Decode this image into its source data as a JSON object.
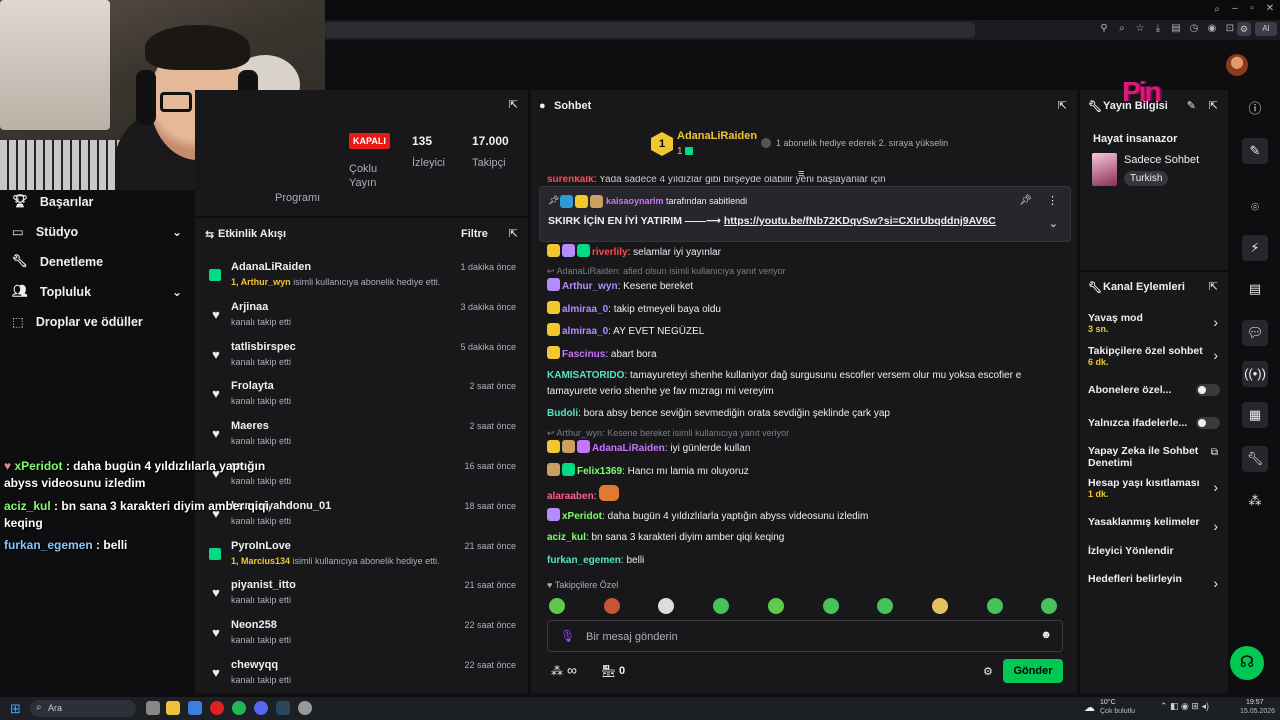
{
  "colors": {
    "accent": "#9147ff",
    "green": "#00db84",
    "send": "#00c853",
    "gold": "#f0c72f",
    "live_red": "#e91916"
  },
  "browser": {
    "taskbar_search": "Ara",
    "clock_time": "19:57",
    "clock_date": "15.05.2026",
    "weather_temp": "10°C",
    "weather_desc": "Çok bulutlu"
  },
  "left_nav": {
    "items": [
      {
        "label": "Başarılar",
        "icon": "trophy-icon"
      },
      {
        "label": "Stüdyo",
        "icon": "studio-icon"
      },
      {
        "label": "Denetleme",
        "icon": "wrench-icon"
      },
      {
        "label": "Topluluk",
        "icon": "community-icon"
      },
      {
        "label": "Droplar ve ödüller",
        "icon": "drops-icon"
      }
    ]
  },
  "overlay_chat": [
    {
      "user": "xPeridot",
      "text": " : daha bugün 4 yıldızlılarla yaptığın abyss videosunu izledim",
      "color": "#7dff6b"
    },
    {
      "user": "aciz_kul",
      "text": " : bn sana 3 karakteri diyim amber qiqi keqing",
      "color": "#7dff6b"
    },
    {
      "user": "furkan_egemen",
      "text": " : belli",
      "color": "#86c6ff"
    }
  ],
  "stats": {
    "program_label": "Programı",
    "live_badge": "KAPALI",
    "mode_label": "Çoklu Yayın",
    "viewers_value": "135",
    "viewers_label": "İzleyici",
    "followers_value": "17.000",
    "followers_label": "Takipçi"
  },
  "activity": {
    "title": "Etkinlik Akışı",
    "filter_label": "Filtre",
    "items": [
      {
        "name": "AdanaLiRaiden",
        "sub_highlight": "1, Arthur_wyn",
        "sub": " isimli kullanıcıya abonelik hediye etti.",
        "time": "1 dakika önce",
        "icon": "gift-icon"
      },
      {
        "name": "Arjinaa",
        "sub_highlight": "",
        "sub": "kanalı takip etti",
        "time": "3 dakika önce",
        "icon": "heart-icon"
      },
      {
        "name": "tatlisbirspec",
        "sub_highlight": "",
        "sub": "kanalı takip etti",
        "time": "5 dakika önce",
        "icon": "heart-icon"
      },
      {
        "name": "Frolayta",
        "sub_highlight": "",
        "sub": "kanalı takip etti",
        "time": "2 saat önce",
        "icon": "heart-icon"
      },
      {
        "name": "Maeres",
        "sub_highlight": "",
        "sub": "kanalı takip etti",
        "time": "2 saat önce",
        "icon": "heart-icon"
      },
      {
        "name": "ra",
        "sub_highlight": "",
        "sub": "kanalı takip etti",
        "time": "16 saat önce",
        "icon": "heart-icon"
      },
      {
        "name": "bunusiyahdonu_01",
        "sub_highlight": "",
        "sub": "kanalı takip etti",
        "time": "18 saat önce",
        "icon": "heart-icon"
      },
      {
        "name": "PyroInLove",
        "sub_highlight": "1, Marcius134",
        "sub": " isimli kullanıcıya abonelik hediye etti.",
        "time": "21 saat önce",
        "icon": "gift-icon"
      },
      {
        "name": "piyanist_itto",
        "sub_highlight": "",
        "sub": "kanalı takip etti",
        "time": "21 saat önce",
        "icon": "heart-icon"
      },
      {
        "name": "Neon258",
        "sub_highlight": "",
        "sub": "kanalı takip etti",
        "time": "22 saat önce",
        "icon": "heart-icon"
      },
      {
        "name": "chewyqq",
        "sub_highlight": "",
        "sub": "kanalı takip etti",
        "time": "22 saat önce",
        "icon": "heart-icon"
      }
    ]
  },
  "chat": {
    "title": "Sohbet",
    "top_gifter": {
      "name": "AdanaLiRaiden",
      "count": "1",
      "rank": "1"
    },
    "gift_hint": "1 abonelik hediye ederek 2. sıraya yükselin",
    "partial_line": {
      "user": "surenkalk",
      "text": ": Yada sadece 4 yıldızlar gibi birşeyde olabilir yeni başlayanlar için"
    },
    "pinned": {
      "pinner": "kaisaoynarim",
      "pinned_by_suffix": " tarafından sabitlendi",
      "text": "SKIRK İÇİN EN İYİ YATIRIM ——⟶ ",
      "link": "https://youtu.be/fNb72KDqvSw?si=CXIrUbqddnj9AV6C"
    },
    "messages": [
      {
        "user": "riverlily",
        "text": ": selamlar iyi yayınlar",
        "color": "#ff4d4d"
      },
      {
        "reply": "AdanaLiRaiden: afied olsun isimli kullanıcıya yanıt veriyor"
      },
      {
        "user": "Arthur_wyn",
        "text": ": Kesene bereket",
        "color": "#b58cff"
      },
      {
        "user": "almiraa_0",
        "text": ": takip etmeyeli baya oldu",
        "color": "#b58cff"
      },
      {
        "user": "almiraa_0",
        "text": ": AY EVET NEGÜZEL",
        "color": "#b58cff"
      },
      {
        "user": "Fascinus",
        "text": ": abart bora",
        "color": "#c774ff"
      },
      {
        "user": "KAMISATORIDO",
        "text": ": tamayureteyi shenhe kullaniyor dağ surgusunu escofier versem olur mu yoksa escofier e tamayurete verio shenhe ye fav mızragı mi vereyim",
        "color": "#55e6c1"
      },
      {
        "user": "Budoli",
        "text": ": bora absy bence seviğin sevmediğin orata sevdiğin şeklinde çark yap",
        "color": "#55e6c1"
      },
      {
        "reply": "Arthur_wyn: Kesene bereket isimli kullanıcıya yanıt veriyor"
      },
      {
        "user": "AdanaLiRaiden",
        "text": ": iyi günlerde kullan",
        "color": "#c774ff"
      },
      {
        "user": "Felix1369",
        "text": ": Hancı mı lamia mı oluyoruz",
        "color": "#7dff6b"
      },
      {
        "user": "alaraaben",
        "text": ":",
        "color": "#ff5e8a"
      },
      {
        "user": "xPeridot",
        "text": ": daha bugün 4 yıldızlılarla yaptığın abyss videosunu izledim",
        "color": "#7dff6b"
      },
      {
        "user": "aciz_kul",
        "text": ": bn sana 3 karakteri diyim amber qiqi keqing",
        "color": "#7dff6b"
      },
      {
        "user": "furkan_egemen",
        "text": ": belli",
        "color": "#55e6c1"
      }
    ],
    "followers_only_label": "Takipçilere Özel",
    "input_placeholder": "Bir mesaj gönderin",
    "points_value": "0",
    "infinity": "∞",
    "send_label": "Gönder"
  },
  "stream_info": {
    "title": "Yayın Bilgisi",
    "stream_title": "Hayat insanazor",
    "category": "Sadece Sohbet",
    "tag": "Turkish",
    "overlay_logo": "Pin"
  },
  "channel_actions": {
    "title": "Kanal Eylemleri",
    "rows": [
      {
        "label": "Yavaş mod",
        "sub": "3 sn.",
        "control": "arrow"
      },
      {
        "label": "Takipçilere özel sohbet",
        "sub": "6 dk.",
        "control": "arrow"
      },
      {
        "label": "Abonelere özel...",
        "sub": "",
        "control": "toggle"
      },
      {
        "label": "Yalnızca ifadelerle...",
        "sub": "",
        "control": "toggle"
      },
      {
        "label": "Yapay Zeka ile Sohbet Denetimi",
        "sub": "",
        "control": "external"
      },
      {
        "label": "Hesap yaşı kısıtlaması",
        "sub": "1 dk.",
        "control": "arrow"
      },
      {
        "label": "Yasaklanmış kelimeler",
        "sub": "",
        "control": "arrow"
      },
      {
        "label": "İzleyici Yönlendir",
        "sub": "",
        "control": "none"
      },
      {
        "label": "Hedefleri belirleyin",
        "sub": "",
        "control": "arrow"
      }
    ]
  }
}
